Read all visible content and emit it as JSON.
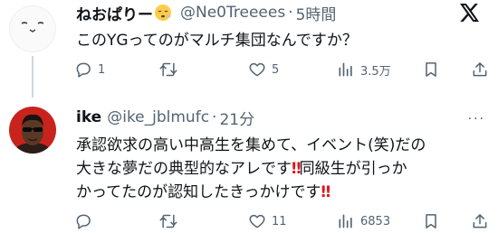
{
  "tweets": [
    {
      "name": "ねおぱりー",
      "emoji": "😮‍💨",
      "handle": "@Ne0Treeees",
      "time": "5時間",
      "text": "このYGってのがマルチ集団なんですか？",
      "replies": "1",
      "retweets": "",
      "likes": "5",
      "views": "3.5万"
    },
    {
      "name": "ike",
      "handle": "@ike_jblmufc",
      "time": "21分",
      "text_line1": "承認欲求の高い中高生を集めて、イベント(笑)だの",
      "text_line2a": "大きな夢だの典型的なアレです",
      "bang1": "‼",
      "text_line2b": "同級生が引っか",
      "text_line3a": "かってたのが認知したきっかけです",
      "bang2": "‼",
      "replies": "",
      "retweets": "",
      "likes": "11",
      "views": "6853"
    }
  ],
  "header": {
    "dot": "·",
    "more": "···"
  },
  "icons": {
    "logo": "x-logo-icon",
    "reply": "reply-icon",
    "retweet": "retweet-icon",
    "like": "heart-icon",
    "views": "views-icon",
    "bookmark": "bookmark-icon",
    "share": "share-icon"
  },
  "colors": {
    "text": "#0f1419",
    "secondary": "#536471",
    "thread_line": "#cfd9de",
    "emphasis": "#e0161c"
  }
}
